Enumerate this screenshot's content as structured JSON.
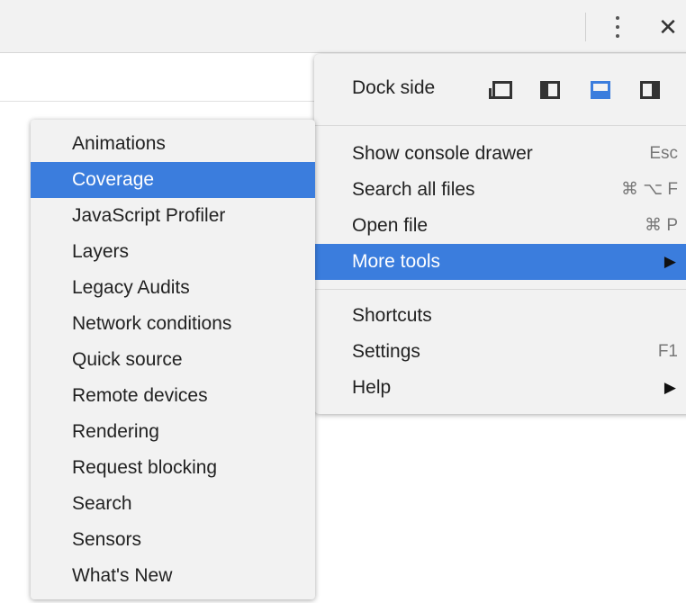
{
  "toolbar": {
    "more_icon": "vertical-ellipsis-icon",
    "close_label": "✕"
  },
  "main_menu": {
    "dock": {
      "label": "Dock side",
      "icons": [
        "undock-icon",
        "dock-left-icon",
        "dock-bottom-icon",
        "dock-right-icon"
      ],
      "active": "dock-bottom-icon"
    },
    "items": [
      {
        "label": "Show console drawer",
        "shortcut": "Esc"
      },
      {
        "label": "Search all files",
        "shortcut": "⌘ ⌥ F"
      },
      {
        "label": "Open file",
        "shortcut": "⌘ P"
      },
      {
        "label": "More tools",
        "submenu_arrow": "▶",
        "selected": true
      },
      {
        "label": "Shortcuts"
      },
      {
        "label": "Settings",
        "shortcut": "F1"
      },
      {
        "label": "Help",
        "submenu_arrow": "▶"
      }
    ]
  },
  "more_tools_menu": {
    "items": [
      "Animations",
      "Coverage",
      "JavaScript Profiler",
      "Layers",
      "Legacy Audits",
      "Network conditions",
      "Quick source",
      "Remote devices",
      "Rendering",
      "Request blocking",
      "Search",
      "Sensors",
      "What's New"
    ],
    "selected": "Coverage"
  },
  "colors": {
    "selection": "#3b7ddd",
    "menu_bg": "#f2f2f2"
  }
}
